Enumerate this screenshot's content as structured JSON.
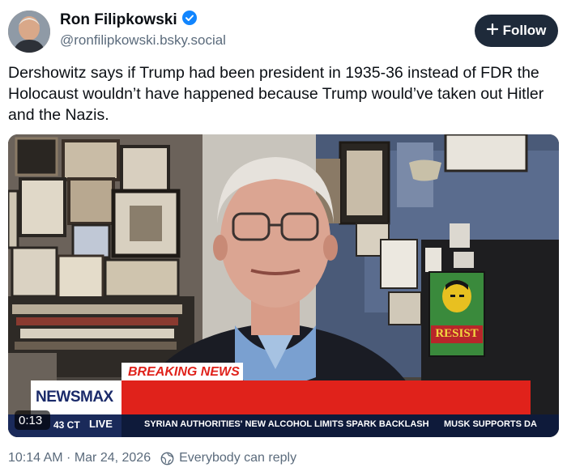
{
  "author": {
    "name": "Ron Filipkowski",
    "handle": "@ronfilipkowski.bsky.social",
    "verified": true
  },
  "follow_button": {
    "label": "Follow"
  },
  "post": {
    "text": "Dershowitz says if Trump had been president in 1935-36 instead of FDR the Holocaust wouldn’t have happened because Trump would’ve taken out Hitler and the Nazis."
  },
  "video": {
    "timestamp": "0:13",
    "breaking_label": "BREAKING NEWS",
    "network": "NEWSMAX",
    "clock": "43 CT",
    "live_label": "LIVE",
    "ticker_1": "SYRIAN AUTHORITIES' NEW ALCOHOL LIMITS SPARK BACKLASH",
    "ticker_2": "MUSK SUPPORTS DA",
    "poster_text": "RESIST"
  },
  "meta": {
    "datetime": "10:14 AM · Mar 24, 2026",
    "reply_setting": "Everybody can reply"
  },
  "colors": {
    "accent_blue": "#1185fe",
    "follow_bg": "#1e2a3a",
    "breaking_red": "#e0221b"
  }
}
